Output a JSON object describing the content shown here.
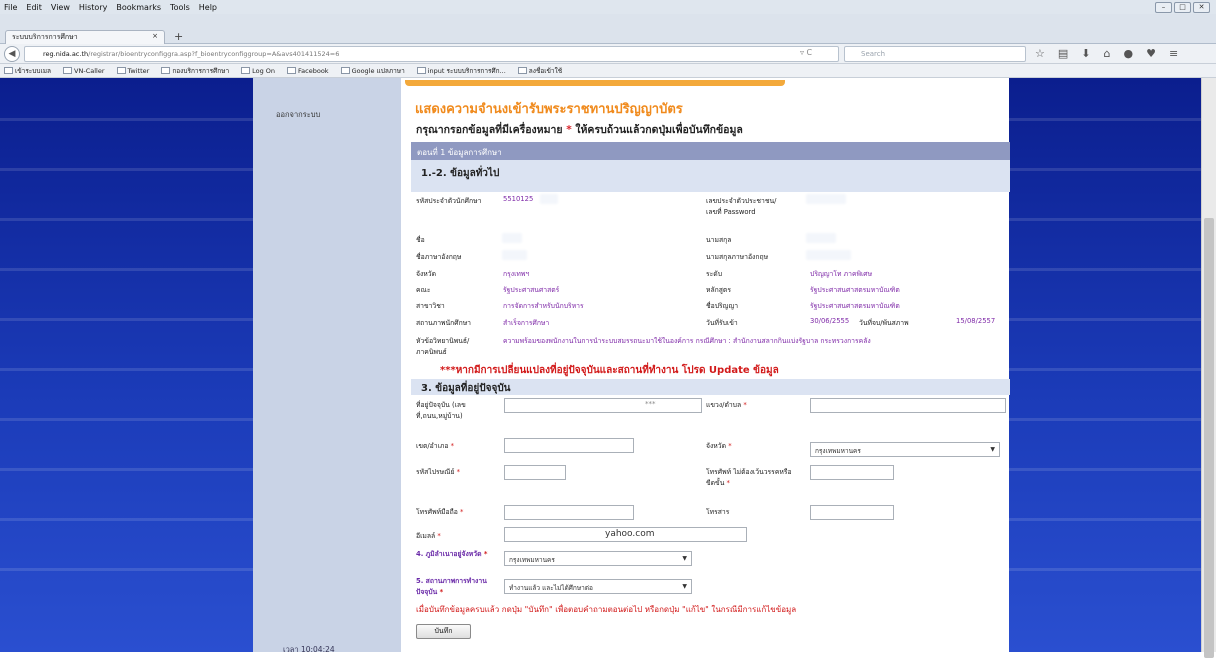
{
  "menu": [
    "File",
    "Edit",
    "View",
    "History",
    "Bookmarks",
    "Tools",
    "Help"
  ],
  "tab_title": "ระบบบริการการศึกษา",
  "url_host": "reg.nida.ac.th",
  "url_path": "/registrar/bioentryconfiggra.asp?f_bioentryconfiggroup=A&avs401411524=6",
  "search_placeholder": "Search",
  "bookmarks": [
    "เข้าระบบเมล",
    "VN-Caller",
    "Twitter",
    "กองบริการการศึกษา",
    "Log On",
    "Facebook",
    "Google แปลภาษา",
    "input ระบบบริการการศึก...",
    "ลงชื่อเข้าใช้"
  ],
  "logout": "ออกจากระบบ",
  "time": "เวลา 10:04:24",
  "page_title": "แสดงความจำนงเข้ารับพระราชทานปริญญาบัตร",
  "instruction_pre": "กรุณากรอกข้อมูลที่มีเครื่องหมาย",
  "instruction_star": "*",
  "instruction_post": "ให้ครบถ้วนแล้วกดปุ่มเพื่อบันทึกข้อมูล",
  "section1": "ตอนที่ 1 ข้อมูลการศึกษา",
  "section12": "1.-2. ข้อมูลทั่วไป",
  "f": {
    "sid_l": "รหัสประจำตัวนักศึกษา",
    "sid_v": "5510125",
    "idcard_l": "เลขประจำตัวประชาชน/เลขที่ Password",
    "name_l": "ชื่อ",
    "surname_l": "นามสกุล",
    "name_en_l": "ชื่อภาษาอังกฤษ",
    "surname_en_l": "นามสกุลภาษาอังกฤษ",
    "prov_l": "จังหวัด",
    "prov_v": "กรุงเทพฯ",
    "level_l": "ระดับ",
    "level_v": "ปริญญาโท ภาคพิเศษ",
    "fac_l": "คณะ",
    "fac_v": "รัฐประศาสนศาสตร์",
    "curr_l": "หลักสูตร",
    "curr_v": "รัฐประศาสนศาสตรมหาบัณฑิต",
    "major_l": "สาขาวิชา",
    "major_v": "การจัดการสำหรับนักบริหาร",
    "deg_l": "ชื่อปริญญา",
    "deg_v": "รัฐประศาสนศาสตรมหาบัณฑิต",
    "status_l": "สถานภาพนักศึกษา",
    "status_v": "สำเร็จการศึกษา",
    "admit_l": "วันที่รับเข้า",
    "admit_v": "30/06/2555",
    "grad_l": "วันที่จบ/พ้นสภาพ",
    "grad_v": "15/08/2557",
    "thesis_l": "หัวข้อวิทยานิพนธ์/ภาคนิพนธ์",
    "thesis_v": "ความพร้อมของพนักงานในการนำระบบสมรรถนะมาใช้ในองค์การ กรณีศึกษา : สำนักงานสลากกินแบ่งรัฐบาล กระทรวงการคลัง"
  },
  "warning": "***หากมีการเปลี่ยนแปลงที่อยู่ปัจจุบันและสถานที่ทำงาน โปรด Update ข้อมูล",
  "section3": "3. ข้อมูลที่อยู่ปัจจุบัน",
  "a": {
    "addr_l": "ที่อยู่ปัจจุบัน (เลขที่,ถนน,หมู่บ้าน)",
    "addr_v": "***",
    "subd_l": "แขวง/ตำบล",
    "dist_l": "เขต/อำเภอ",
    "prov_l": "จังหวัด",
    "prov_v": "กรุงเทพมหานคร",
    "zip_l": "รหัสไปรษณีย์",
    "tel_l": "โทรศัพท์ ไม่ต้องเว้นวรรคหรือขีดขั้น",
    "mob_l": "โทรศัพท์มือถือ",
    "fax_l": "โทรสาร",
    "email_l": "อีเมลล์",
    "email_v": "yahoo.com",
    "star": "*"
  },
  "s4_l": "4. ภูมิลำเนาอยู่จังหวัด",
  "s4_v": "กรุงเทพมหานคร",
  "s5_l": "5. สถานภาพการทำงานปัจจุบัน",
  "s5_v": "ทำงานแล้ว และไม่ได้ศึกษาต่อ",
  "footer": "เมื่อบันทึกข้อมูลครบแล้ว กดปุ่ม \"บันทึก\" เพื่อตอบคำถามตอนต่อไป หรือกดปุ่ม \"แก้ไข\" ในกรณีมีการแก้ไขข้อมูล",
  "submit": "บันทึก"
}
